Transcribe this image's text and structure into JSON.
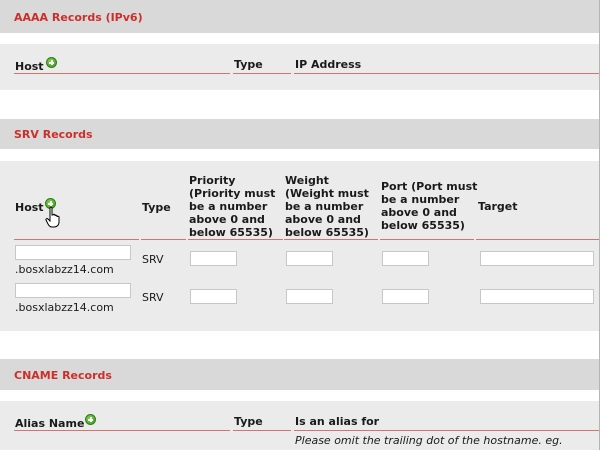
{
  "aaaa": {
    "title": "AAAA Records (IPv6)",
    "columns": {
      "host": "Host",
      "type": "Type",
      "ip": "IP Address"
    }
  },
  "srv": {
    "title": "SRV Records",
    "columns": {
      "host": "Host",
      "type": "Type",
      "priority": [
        "Priority",
        "(Priority must",
        "be a number",
        "above 0 and",
        "below 65535)"
      ],
      "weight": [
        "Weight",
        "(Weight must",
        "be a number",
        "above 0 and",
        "below 65535)"
      ],
      "port": [
        "Port (Port must",
        "be a number",
        "above 0 and",
        "below 65535)"
      ],
      "target": "Target"
    },
    "rows": [
      {
        "host_value": "",
        "domain_suffix": ".bosxlabzz14.com",
        "type": "SRV",
        "priority": "",
        "weight": "",
        "port": "",
        "target": ""
      },
      {
        "host_value": "",
        "domain_suffix": ".bosxlabzz14.com",
        "type": "SRV",
        "priority": "",
        "weight": "",
        "port": "",
        "target": ""
      }
    ]
  },
  "cname": {
    "title": "CNAME Records",
    "columns": {
      "alias": "Alias Name",
      "type": "Type",
      "alias_for": "Is an alias for"
    },
    "note": "Please omit the trailing dot of the hostname. eg."
  },
  "icons": {
    "add": "add-plus-icon",
    "cursor": "hand-pointer-icon"
  },
  "colors": {
    "section_title": "#cc2f2a",
    "header_band": "#d9d9d9",
    "table_band": "#ebebeb",
    "underline": "#d6736f",
    "add_icon": "#3a9a1f"
  }
}
